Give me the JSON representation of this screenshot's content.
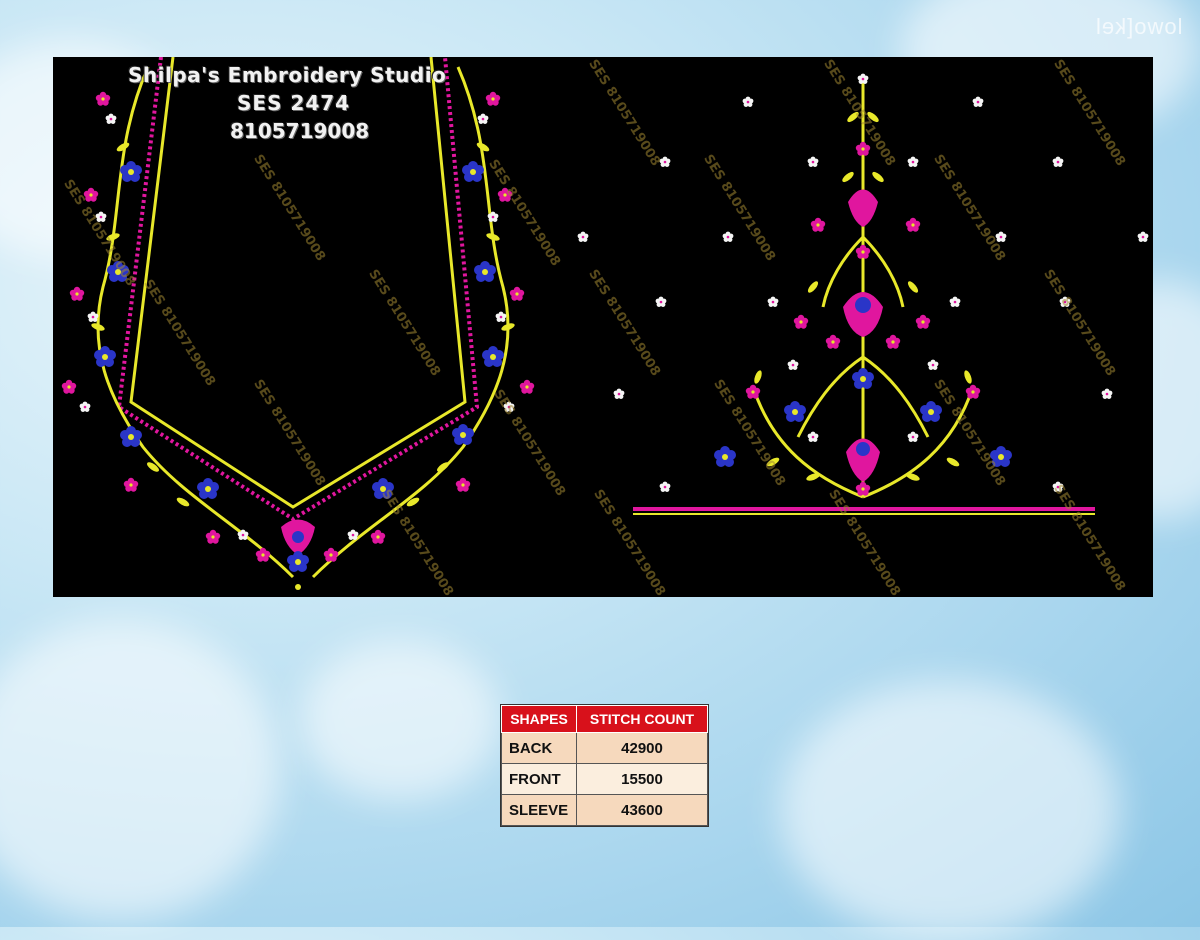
{
  "corner_mark": "lowo[kel",
  "studio": {
    "name": "Shilpa's Embroidery Studio",
    "design_code": "SES 2474",
    "phone": "8105719008"
  },
  "watermark_text": "SES 8105719008",
  "table": {
    "headers": [
      "SHAPES",
      "STITCH COUNT"
    ],
    "rows": [
      {
        "shape": "BACK",
        "count": "42900"
      },
      {
        "shape": "FRONT",
        "count": "15500"
      },
      {
        "shape": "SLEEVE",
        "count": "43600"
      }
    ]
  },
  "colors": {
    "embroidery_yellow": "#e8e82a",
    "embroidery_magenta": "#e0169e",
    "embroidery_blue": "#2a35c8",
    "table_header_red": "#d8111b",
    "panel_black": "#000000"
  }
}
